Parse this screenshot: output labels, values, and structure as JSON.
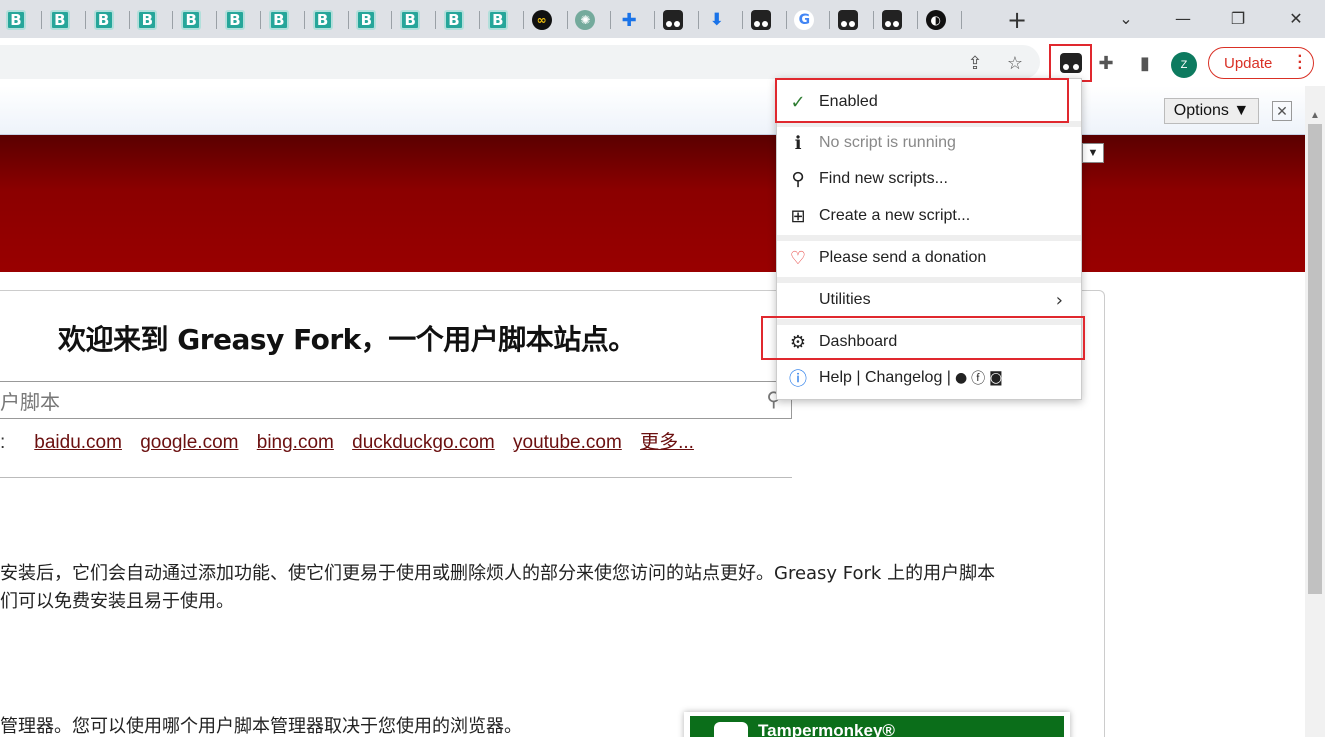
{
  "tabs": [
    {
      "icon": "bilibili-icon",
      "glyph": "B"
    },
    {
      "icon": "bilibili-icon",
      "glyph": "B"
    },
    {
      "icon": "bilibili-icon",
      "glyph": "B"
    },
    {
      "icon": "bilibili-icon",
      "glyph": "B"
    },
    {
      "icon": "bilibili-icon",
      "glyph": "B"
    },
    {
      "icon": "bilibili-icon",
      "glyph": "B"
    },
    {
      "icon": "bilibili-icon",
      "glyph": "B"
    },
    {
      "icon": "bilibili-icon",
      "glyph": "B"
    },
    {
      "icon": "bilibili-icon",
      "glyph": "B"
    },
    {
      "icon": "bilibili-icon",
      "glyph": "B"
    },
    {
      "icon": "bilibili-icon",
      "glyph": "B"
    },
    {
      "icon": "bilibili-icon",
      "glyph": "B"
    },
    {
      "icon": "infinity-icon",
      "glyph": "∞"
    },
    {
      "icon": "openai-icon",
      "glyph": "✺"
    },
    {
      "icon": "extension-icon",
      "glyph": "✚"
    },
    {
      "icon": "tampermonkey-icon",
      "glyph": ""
    },
    {
      "icon": "download-icon",
      "glyph": "⬇"
    },
    {
      "icon": "tampermonkey-icon",
      "glyph": ""
    },
    {
      "icon": "google-icon",
      "glyph": "G"
    },
    {
      "icon": "tampermonkey-icon",
      "glyph": ""
    },
    {
      "icon": "tampermonkey-icon",
      "glyph": ""
    },
    {
      "icon": "dark-site-icon",
      "glyph": "◐"
    }
  ],
  "toolbar": {
    "profile_initial": "Z",
    "update_label": "Update"
  },
  "translate_bar": {
    "options_label": "Options ▼",
    "close_label": "✕"
  },
  "page": {
    "welcome": "欢迎来到 Greasy Fork，一个用户脚本站点。",
    "search_placeholder": "户脚本",
    "sites_prefix": ":",
    "sites": [
      "baidu.com",
      "google.com",
      "bing.com",
      "duckduckgo.com",
      "youtube.com",
      "更多..."
    ],
    "para1_line1": "安装后，它们会自动通过添加功能、使它们更易于使用或删除烦人的部分来使您访问的站点更好。Greasy Fork 上的用户脚本",
    "para1_line2": "们可以免费安装且易于使用。",
    "para2": "管理器。您可以使用哪个用户脚本管理器取决于您使用的浏览器。",
    "card_title": "Tampermonkey®"
  },
  "menu": {
    "enabled": "Enabled",
    "no_script": "No script is running",
    "find_scripts": "Find new scripts...",
    "create_script": "Create a new script...",
    "donation": "Please send a donation",
    "utilities": "Utilities",
    "dashboard": "Dashboard",
    "help": "Help | Changelog |"
  },
  "colors": {
    "highlight": "#e0282e",
    "header": "#8b0000",
    "link": "#6b1010"
  }
}
